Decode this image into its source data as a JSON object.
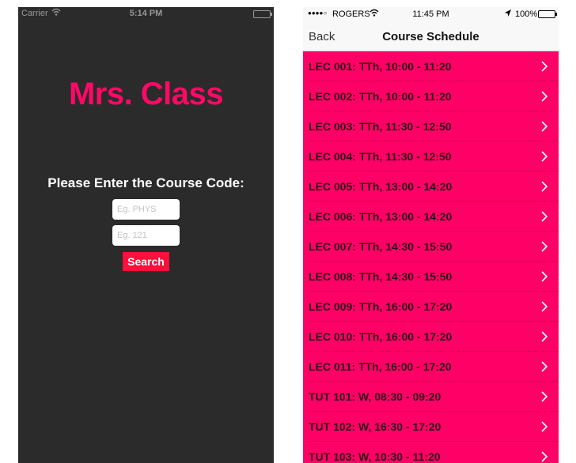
{
  "left": {
    "status": {
      "carrier": "Carrier",
      "time": "5:14 PM"
    },
    "title": "Mrs. Class",
    "prompt": "Please Enter the Course Code:",
    "subject_placeholder": "Eg. PHYS",
    "number_placeholder": "Eg. 121",
    "search_label": "Search"
  },
  "right": {
    "status": {
      "signal": "●●●●○",
      "carrier": "ROGERS",
      "time": "11:45 PM",
      "battery": "100%"
    },
    "nav": {
      "back": "Back",
      "title": "Course Schedule"
    },
    "sections": [
      {
        "label": "LEC 001: TTh, 10:00 - 11:20"
      },
      {
        "label": "LEC 002: TTh, 10:00 - 11:20"
      },
      {
        "label": "LEC 003: TTh, 11:30 - 12:50"
      },
      {
        "label": "LEC 004: TTh, 11:30 - 12:50"
      },
      {
        "label": "LEC 005: TTh, 13:00 - 14:20"
      },
      {
        "label": "LEC 006: TTh, 13:00 - 14:20"
      },
      {
        "label": "LEC 007: TTh, 14:30 - 15:50"
      },
      {
        "label": "LEC 008: TTh, 14:30 - 15:50"
      },
      {
        "label": "LEC 009: TTh, 16:00 - 17:20"
      },
      {
        "label": "LEC 010: TTh, 16:00 - 17:20"
      },
      {
        "label": "LEC 011: TTh, 16:00 - 17:20"
      },
      {
        "label": "TUT 101: W, 08:30 - 09:20"
      },
      {
        "label": "TUT 102: W, 16:30 - 17:20"
      },
      {
        "label": "TUT 103: W, 10:30 - 11:20"
      }
    ]
  },
  "colors": {
    "accent_pink": "#ff0866",
    "list_background": "#ff0066",
    "search_button": "#ff0f3b",
    "left_background": "#2b2b2b"
  }
}
